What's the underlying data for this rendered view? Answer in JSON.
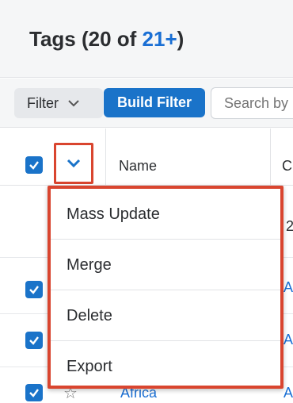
{
  "header": {
    "title_prefix": "Tags (20 of ",
    "title_count": "21+",
    "title_suffix": ")"
  },
  "filterbar": {
    "filter_label": "Filter",
    "build_filter_label": "Build Filter",
    "search_placeholder": "Search by name..."
  },
  "table": {
    "columns": [
      "Name",
      "Cr"
    ],
    "partial_text": {
      "row1_col2": "2",
      "row2_col2": "A",
      "row3_col2": "A",
      "row4_col2": "A"
    },
    "last_row_name": "Africa",
    "last_row_col2": "A"
  },
  "action_menu": {
    "items": [
      "Mass Update",
      "Merge",
      "Delete",
      "Export"
    ]
  },
  "colors": {
    "accent": "#1a73c9",
    "link": "#1a6fd4",
    "highlight": "#d9452f"
  }
}
